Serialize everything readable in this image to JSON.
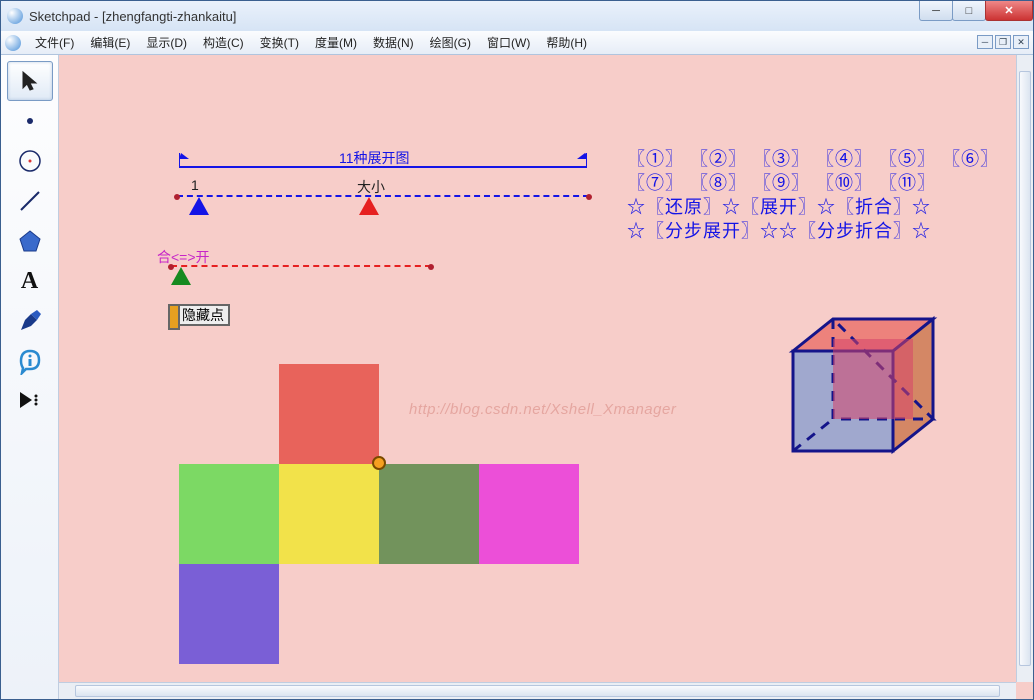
{
  "window": {
    "title": "Sketchpad  - [zhengfangti-zhankaitu]"
  },
  "menu": [
    "文件(F)",
    "编辑(E)",
    "显示(D)",
    "构造(C)",
    "变换(T)",
    "度量(M)",
    "数据(N)",
    "绘图(G)",
    "窗口(W)",
    "帮助(H)"
  ],
  "canvas": {
    "brace_title": "11种展开图",
    "slider1": {
      "min_label": "1",
      "size_label": "大小"
    },
    "slider2": {
      "label": "合<=>开"
    },
    "hide_button": "隐藏点",
    "watermark": "http://blog.csdn.net/Xshell_Xmanager",
    "net_colors": {
      "top": "#e8635b",
      "left": "#7cd964",
      "center": "#f2e24a",
      "right1": "#72935c",
      "right2": "#ec4fd8",
      "bottom": "#7a5fd6"
    }
  },
  "links": {
    "row1": [
      "〖①〗",
      "〖②〗",
      "〖③〗",
      "〖④〗",
      "〖⑤〗",
      "〖⑥〗"
    ],
    "row2": [
      "〖⑦〗",
      "〖⑧〗",
      "〖⑨〗",
      "〖⑩〗",
      "〖⑪〗"
    ],
    "row3": "☆〖还原〗☆〖展开〗☆〖折合〗☆",
    "row4": "☆〖分步展开〗☆☆〖分步折合〗☆"
  }
}
